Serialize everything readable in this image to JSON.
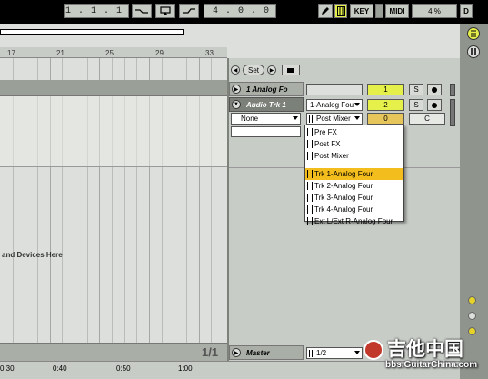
{
  "transport": {
    "position": "1 . 1 . 1",
    "loop_length": "4 . 0 . 0",
    "key_label": "KEY",
    "midi_label": "MIDI",
    "cpu": "4 %",
    "d_label": "D"
  },
  "arrangement": {
    "ruler_bars": [
      "17",
      "21",
      "25",
      "29",
      "33"
    ],
    "drop_hint": "and Devices Here",
    "page_indicator": "1/1",
    "time_marks": [
      "0:30",
      "0:40",
      "0:50",
      "1:00"
    ]
  },
  "locators": {
    "set_label": "Set"
  },
  "tracks": [
    {
      "name": "1 Analog Fo",
      "number": "1",
      "solo": "S"
    },
    {
      "name": "Audio Trk 1",
      "input": "1-Analog Fou",
      "monitor": "None",
      "output": "Post Mixer",
      "number": "2",
      "volume": "0",
      "solo": "S",
      "pan": "C"
    }
  ],
  "master": {
    "name": "Master",
    "cue_out": "1/2"
  },
  "dropdown": {
    "items": [
      "Pre FX",
      "Post FX",
      "Post Mixer",
      "Trk 1-Analog Four",
      "Trk 2-Analog Four",
      "Trk 3-Analog Four",
      "Trk 4-Analog Four",
      "Ext L/Ext R-Analog Four"
    ],
    "highlighted_index": 3
  },
  "watermark": {
    "text": "吉他中国",
    "url": "bbs.GuitarChina.com"
  },
  "colors": {
    "accent_yellow": "#e5f04a",
    "highlight_orange": "#f3bd1e",
    "panel_gray": "#c8ccc7"
  }
}
